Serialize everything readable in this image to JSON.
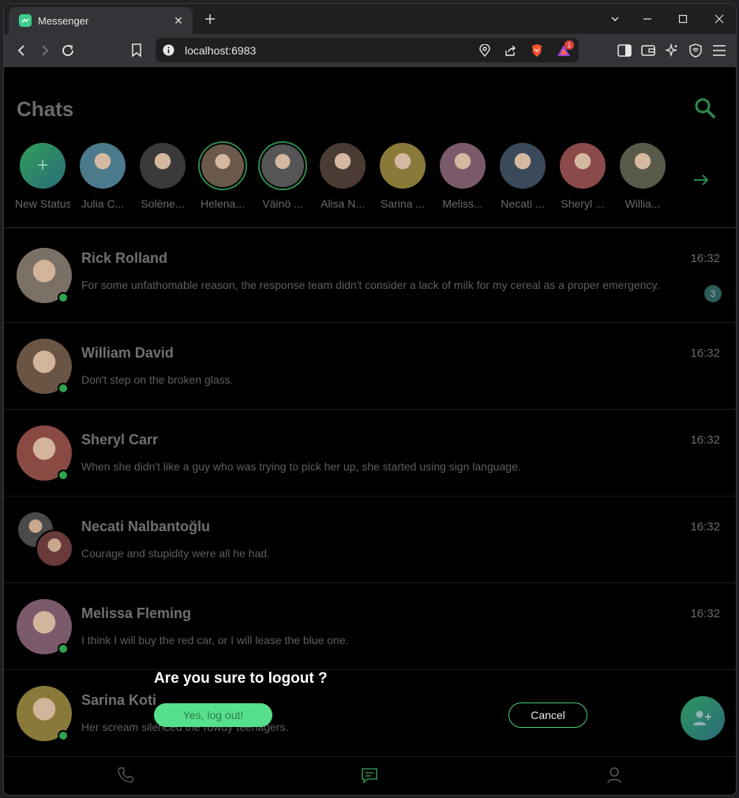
{
  "browser": {
    "tab_title": "Messenger",
    "url": "localhost:6983",
    "notification_count": "1"
  },
  "app": {
    "title": "Chats",
    "stories": [
      {
        "name": "New Status",
        "color": "#2f9e57",
        "active": false,
        "is_new": true
      },
      {
        "name": "Julia C...",
        "color": "#4a7a8c",
        "active": false
      },
      {
        "name": "Solène...",
        "color": "#3a3a3a",
        "active": false
      },
      {
        "name": "Helena...",
        "color": "#6b5a4a",
        "active": true
      },
      {
        "name": "Väinö ...",
        "color": "#555555",
        "active": true
      },
      {
        "name": "Alisa N...",
        "color": "#4a3c34",
        "active": false
      },
      {
        "name": "Sarina ...",
        "color": "#8a7a3a",
        "active": false
      },
      {
        "name": "Meliss...",
        "color": "#7a5a6a",
        "active": false
      },
      {
        "name": "Necati ...",
        "color": "#3a4a5a",
        "active": false
      },
      {
        "name": "Sheryl ...",
        "color": "#8a4a4a",
        "active": false
      },
      {
        "name": "Willia...",
        "color": "#5a5a4a",
        "active": false
      }
    ],
    "chats": [
      {
        "name": "Rick Rolland",
        "time": "16:32",
        "message": "For some unfathomable reason, the response team didn't consider a lack of milk for my cereal as a proper emergency.",
        "unread": "3",
        "color": "#7a7066",
        "online": true
      },
      {
        "name": "William David",
        "time": "16:32",
        "message": "Don't step on the broken glass.",
        "unread": "",
        "color": "#6a5444",
        "online": true
      },
      {
        "name": "Sheryl Carr",
        "time": "16:32",
        "message": "When she didn't like a guy who was trying to pick her up, she started using sign language.",
        "unread": "",
        "color": "#8a4a44",
        "online": true
      },
      {
        "name": "Necati Nalbantoğlu",
        "time": "16:32",
        "message": "Courage and stupidity were all he had.",
        "unread": "",
        "color": "#5a5a5a",
        "online": false,
        "group": true
      },
      {
        "name": "Melissa Fleming",
        "time": "16:32",
        "message": "I think I will buy the red car, or I will lease the blue one.",
        "unread": "",
        "color": "#7a5a6a",
        "online": true
      },
      {
        "name": "Sarina Koti",
        "time": "",
        "message": "Her scream silenced the rowdy teenagers.",
        "unread": "",
        "color": "#8a7a3a",
        "online": true
      }
    ],
    "logout_dialog": {
      "question": "Are you sure to logout ?",
      "confirm_label": "Yes, log out!",
      "cancel_label": "Cancel"
    }
  }
}
